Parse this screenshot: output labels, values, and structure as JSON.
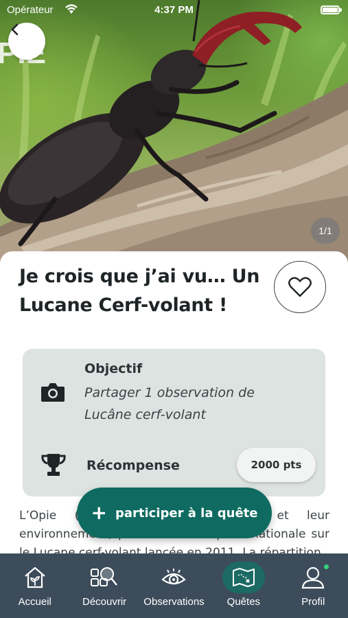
{
  "status_bar": {
    "carrier": "Opérateur",
    "time": "4:37 PM"
  },
  "hero": {
    "photo_subject": "Lucane cerf-volant sur un tronc",
    "image_counter": "1/1"
  },
  "quest": {
    "title": "Je crois que j’ai vu… Un Lucane Cerf-volant !",
    "objective_label": "Objectif",
    "objective_text": "Partager 1 observation de Lucâne cerf-volant",
    "reward_label": "Récompense",
    "reward_points": "2000 pts",
    "description": "L’Opie (Office pour les insectes et leur environnement) poursuit son enquête nationale sur le Lucane cerf-volant lancée en 2011. La répartition"
  },
  "cta": {
    "label": "participer à la quête"
  },
  "tabbar": {
    "active_tab": "Quêtes",
    "items": [
      {
        "label": "Accueil",
        "icon": "house-icon"
      },
      {
        "label": "Découvrir",
        "icon": "discover-icon"
      },
      {
        "label": "Observations",
        "icon": "eye-icon"
      },
      {
        "label": "Quêtes",
        "icon": "map-icon"
      },
      {
        "label": "Profil",
        "icon": "user-icon"
      }
    ]
  },
  "colors": {
    "primary": "#0f6b61",
    "tabbar_bg": "#3d4c5a",
    "objective_bg": "#dde3e1",
    "notification_dot": "#38d27d"
  }
}
